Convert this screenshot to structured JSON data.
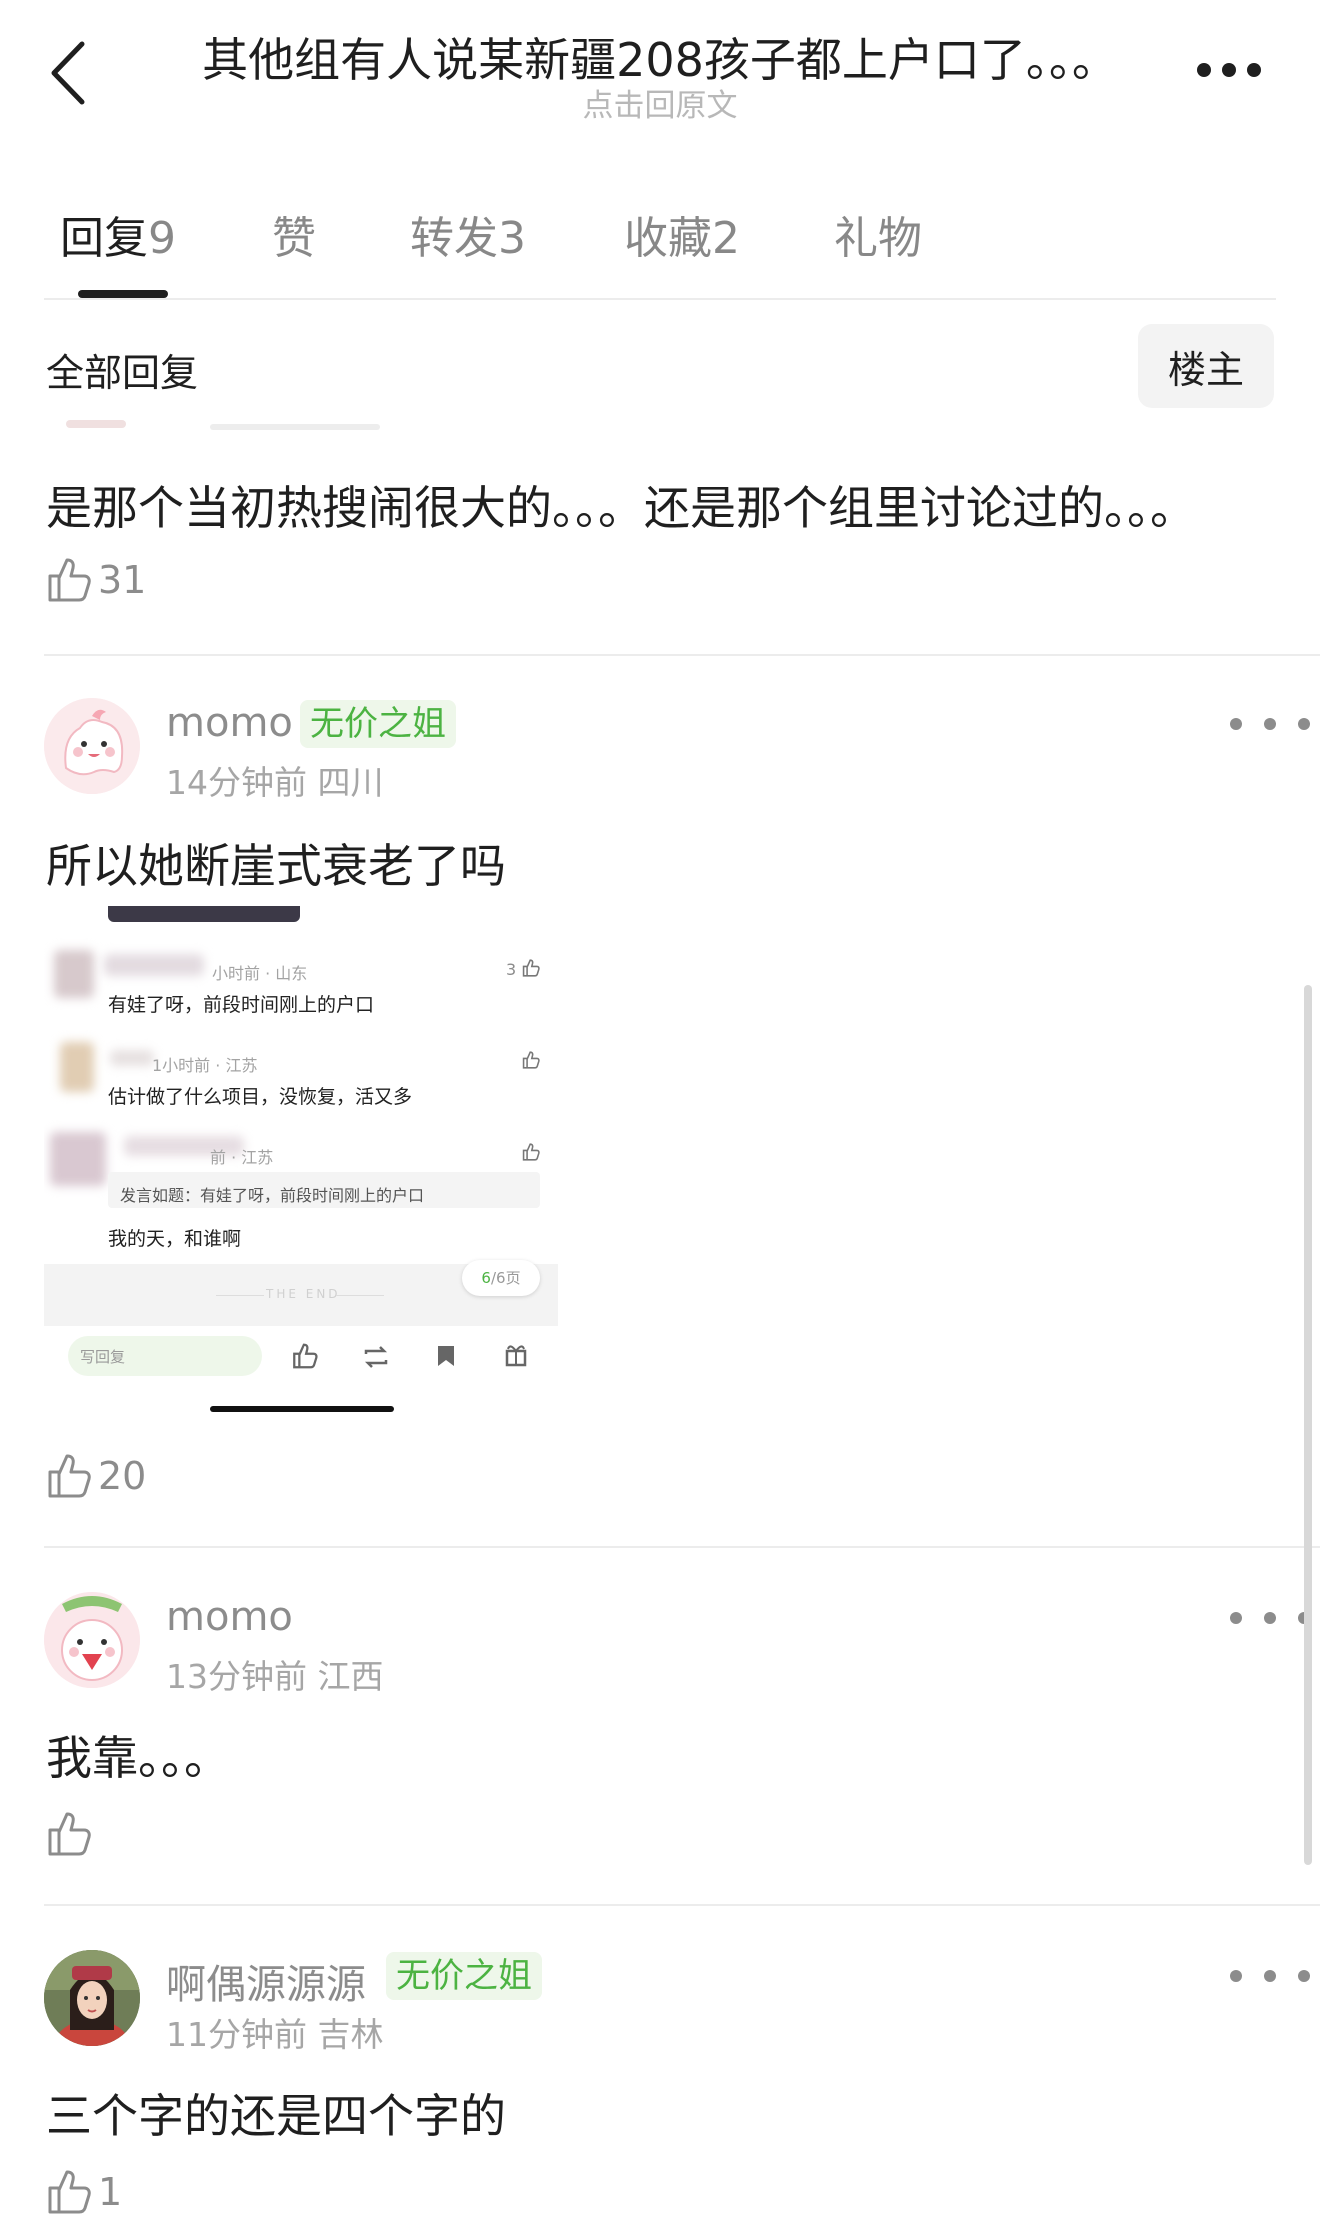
{
  "header": {
    "title": "其他组有人说某新疆208孩子都上户口了。。。",
    "subtitle": "点击回原文"
  },
  "tabs": [
    {
      "label": "回复",
      "count": "9"
    },
    {
      "label": "赞",
      "count": ""
    },
    {
      "label": "转发",
      "count": "3"
    },
    {
      "label": "收藏",
      "count": "2"
    },
    {
      "label": "礼物",
      "count": ""
    }
  ],
  "filter": {
    "all_replies": "全部回复",
    "op_only": "楼主"
  },
  "comments": [
    {
      "text": "是那个当初热搜闹很大的。。。还是那个组里讨论过的。。。",
      "likes": "31"
    },
    {
      "username": "momo",
      "badge": "无价之姐",
      "time": "14分钟前",
      "location": "四川",
      "text": "所以她断崖式衰老了吗",
      "likes": "20"
    },
    {
      "username": "momo",
      "badge": "",
      "time": "13分钟前",
      "location": "江西",
      "text": "我靠。。。",
      "likes": ""
    },
    {
      "username": "啊偶源源源",
      "badge": "无价之姐",
      "time": "11分钟前",
      "location": "吉林",
      "text": "三个字的还是四个字的",
      "likes": "1"
    }
  ],
  "embedded_screenshot": {
    "rows": [
      {
        "meta": "小时前 · 山东",
        "text": "有娃了呀，前段时间刚上的户口",
        "likes": "3"
      },
      {
        "meta": "1小时前 · 江苏",
        "text": "估计做了什么项目，没恢复，活又多",
        "likes": ""
      },
      {
        "meta": "前 · 江苏",
        "quote": "发言如题：有娃了呀，前段时间刚上的户口",
        "text": "我的天，和谁啊",
        "likes": ""
      }
    ],
    "page_current": "6",
    "page_total": "/6页",
    "end_text": "THE END",
    "reply_placeholder": "写回复"
  },
  "colors": {
    "accent_green": "#4cb342",
    "badge_bg": "#eef7ea",
    "text_main": "#1f1f1f",
    "text_muted": "#8c8c8c"
  }
}
